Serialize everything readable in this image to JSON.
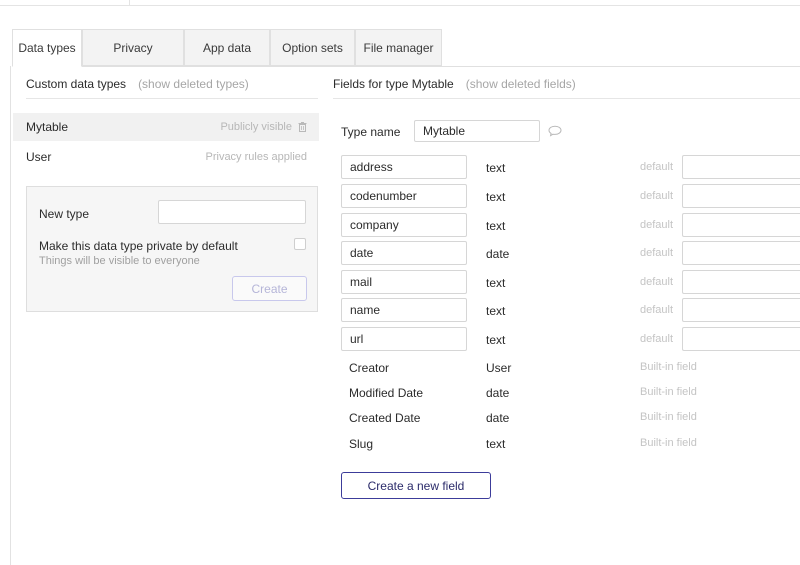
{
  "tabs": [
    {
      "label": "Data types",
      "active": true
    },
    {
      "label": "Privacy"
    },
    {
      "label": "App data"
    },
    {
      "label": "Option sets"
    },
    {
      "label": "File manager"
    }
  ],
  "left": {
    "heading": "Custom data types",
    "show_deleted": "(show deleted types)",
    "types": [
      {
        "name": "Mytable",
        "status": "Publicly visible",
        "selected": true
      },
      {
        "name": "User",
        "status": "Privacy rules applied"
      }
    ],
    "new_type": {
      "label": "New type",
      "input_value": "",
      "private_label": "Make this data type private by default",
      "private_sub": "Things will be visible to everyone",
      "create_label": "Create"
    }
  },
  "right": {
    "heading": "Fields for type Mytable",
    "show_deleted": "(show deleted fields)",
    "type_name_label": "Type name",
    "type_name_value": "Mytable",
    "default_label": "default",
    "fields": [
      {
        "name": "address",
        "type": "text"
      },
      {
        "name": "codenumber",
        "type": "text"
      },
      {
        "name": "company",
        "type": "text"
      },
      {
        "name": "date",
        "type": "date"
      },
      {
        "name": "mail",
        "type": "text"
      },
      {
        "name": "name",
        "type": "text"
      },
      {
        "name": "url",
        "type": "text"
      }
    ],
    "builtin_note": "Built-in field",
    "builtin": [
      {
        "name": "Creator",
        "type": "User"
      },
      {
        "name": "Modified Date",
        "type": "date"
      },
      {
        "name": "Created Date",
        "type": "date"
      },
      {
        "name": "Slug",
        "type": "text"
      }
    ],
    "create_field_label": "Create a new field"
  },
  "icons": {
    "trash": "trash-icon",
    "comment": "comment-icon",
    "checkbox": "checkbox"
  },
  "colors": {
    "accent_border": "#3c3c9a",
    "muted_text": "#a6a6a6",
    "selected_row": "#f1f1f1"
  }
}
